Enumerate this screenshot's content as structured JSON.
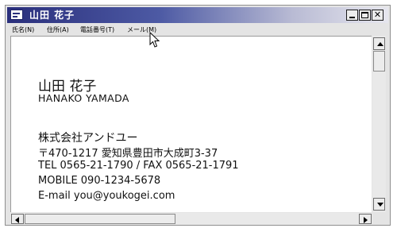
{
  "window": {
    "title": "山田 花子",
    "icon": "card-icon",
    "controls": {
      "minimize": "minimize-icon",
      "maximize": "maximize-icon",
      "close": "close-icon",
      "close_glyph": "✕"
    }
  },
  "menu": [
    {
      "label": "氏名(N)"
    },
    {
      "label": "住所(A)"
    },
    {
      "label": "電話番号(T)"
    },
    {
      "label": "メール(M)"
    }
  ],
  "card": {
    "name_jp": "山田 花子",
    "name_en": "HANAKO YAMADA",
    "company": "株式会社アンドユー",
    "address": "〒470-1217 愛知県豊田市大成町3-37",
    "tel_fax": "TEL 0565-21-1790 / FAX 0565-21-1791",
    "mobile": "MOBILE 090-1234-5678",
    "email": "E-mail you@youkogei.com"
  },
  "scrollbars": {
    "vertical": {
      "up": "arrow-up-icon",
      "down": "arrow-down-icon",
      "position": 0.0
    },
    "horizontal": {
      "left": "arrow-left-icon",
      "right": "arrow-right-icon",
      "position": 0.0
    }
  },
  "colors": {
    "titlebar_start": "#2a2f7c",
    "titlebar_end": "#e6e6ee",
    "window_bg": "#e4e4e4",
    "content_bg": "#ffffff",
    "text": "#111111"
  }
}
